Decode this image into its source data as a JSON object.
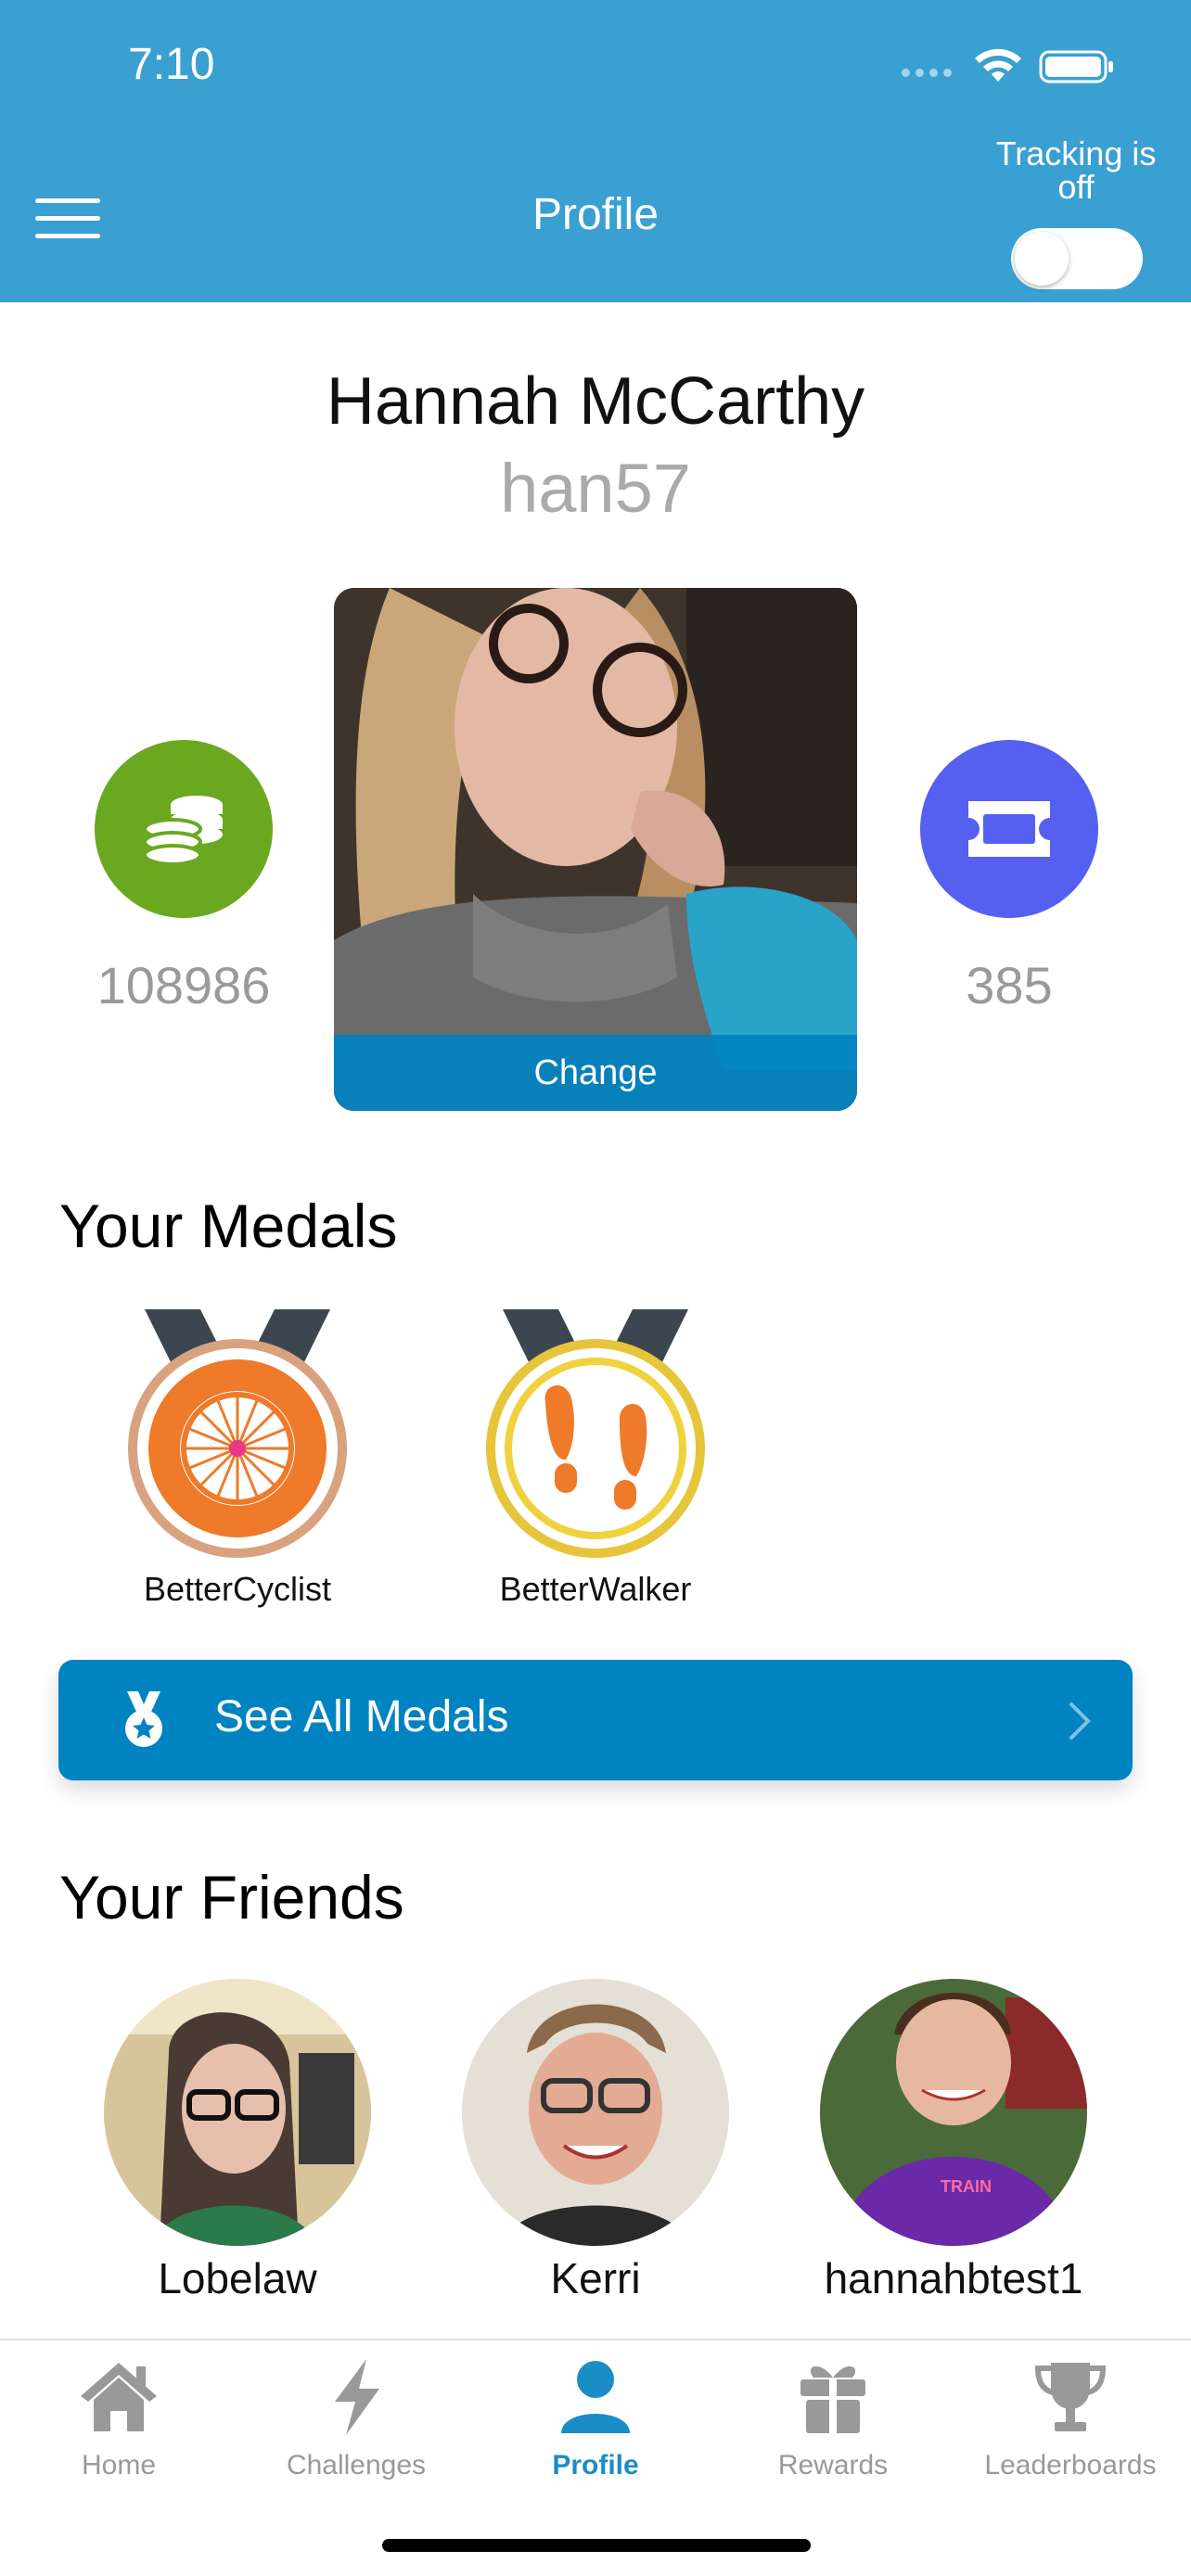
{
  "status_bar": {
    "time": "7:10"
  },
  "header": {
    "title": "Profile",
    "tracking_label": "Tracking is off",
    "tracking_on": false
  },
  "profile": {
    "name": "Hannah McCarthy",
    "username": "han57",
    "change_label": "Change"
  },
  "stats": {
    "coins": {
      "value": "108986",
      "icon": "coins-icon",
      "color": "#6aa820"
    },
    "tickets": {
      "value": "385",
      "icon": "ticket-icon",
      "color": "#5560f0"
    }
  },
  "medals": {
    "title": "Your Medals",
    "items": [
      {
        "label": "BetterCyclist",
        "icon": "bicycle-wheel-icon"
      },
      {
        "label": "BetterWalker",
        "icon": "footprints-icon"
      }
    ],
    "see_all_label": "See All Medals"
  },
  "friends": {
    "title": "Your Friends",
    "items": [
      {
        "name": "Lobelaw"
      },
      {
        "name": "Kerri"
      },
      {
        "name": "hannahbtest1"
      }
    ]
  },
  "tabbar": {
    "items": [
      {
        "label": "Home",
        "icon": "home-icon",
        "active": false
      },
      {
        "label": "Challenges",
        "icon": "lightning-icon",
        "active": false
      },
      {
        "label": "Profile",
        "icon": "person-icon",
        "active": true
      },
      {
        "label": "Rewards",
        "icon": "gift-icon",
        "active": false
      },
      {
        "label": "Leaderboards",
        "icon": "trophy-icon",
        "active": false
      }
    ]
  },
  "colors": {
    "header": "#3aa0d1",
    "primary": "#0083c1",
    "active_tab": "#1a8dc7"
  }
}
